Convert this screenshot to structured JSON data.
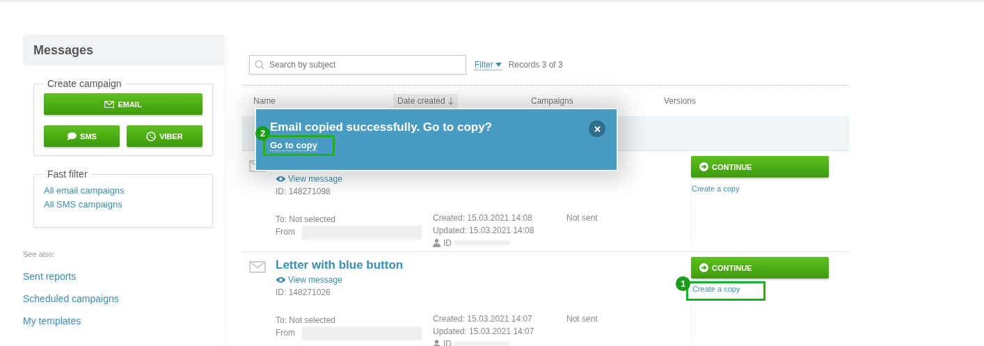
{
  "sidebar": {
    "title": "Messages",
    "create_campaign": {
      "legend": "Create campaign",
      "buttons": [
        {
          "kind": "email",
          "label": "EMAIL"
        },
        {
          "kind": "sms",
          "label": "SMS"
        },
        {
          "kind": "viber",
          "label": "VIBER"
        }
      ]
    },
    "fast_filter": {
      "legend": "Fast filter",
      "links": [
        "All email campaigns",
        "All SMS campaigns"
      ]
    },
    "see_also": {
      "label": "See also:",
      "links": [
        "Sent reports",
        "Scheduled campaigns",
        "My templates"
      ]
    }
  },
  "toolbar": {
    "search": {
      "placeholder": "Search by subject"
    },
    "filter": "Filter",
    "records": "Records 3 of 3"
  },
  "table": {
    "columns": [
      {
        "label": "Name",
        "sorted": false
      },
      {
        "label": "Date created",
        "sorted": true
      },
      {
        "label": "Campaigns",
        "sorted": false
      },
      {
        "label": "Versions",
        "sorted": false
      }
    ],
    "rows": [
      {
        "view_link": "View message",
        "id": "ID: 148271098",
        "to": "To: Not selected",
        "from_label": "From",
        "created": "Created: 15.03.2021 14:08",
        "updated": "Updated: 15.03.2021 14:08",
        "author_id": "ID",
        "status": "Not sent",
        "continue": "CONTINUE",
        "copy_link": "Create a copy"
      },
      {
        "title": "Letter with blue button",
        "view_link": "View message",
        "id": "ID: 148271026",
        "to": "To: Not selected",
        "from_label": "From",
        "created": "Created: 15.03.2021 14:07",
        "updated": "Updated: 15.03.2021 14:07",
        "author_id": "ID",
        "status": "Not sent",
        "continue": "CONTINUE",
        "copy_link": "Create a copy",
        "annotation": "1"
      }
    ]
  },
  "popup": {
    "message": "Email copied successfully. Go to copy?",
    "link": "Go to copy",
    "annotation": "2"
  }
}
